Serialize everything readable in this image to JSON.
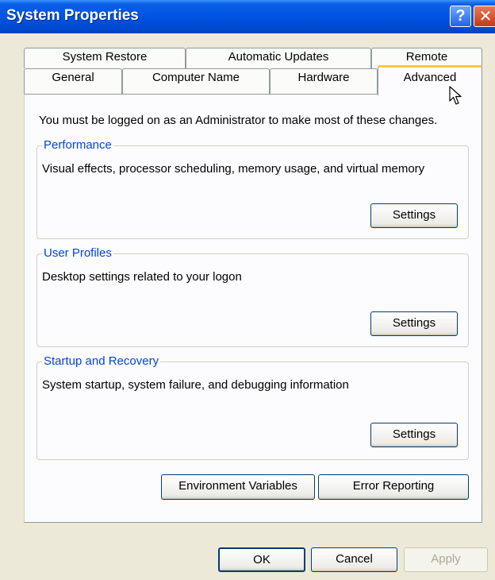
{
  "window": {
    "title": "System Properties",
    "help_glyph": "?",
    "close_glyph": "✕"
  },
  "tabs": {
    "top_row": [
      "System Restore",
      "Automatic Updates",
      "Remote"
    ],
    "bottom_row": [
      "General",
      "Computer Name",
      "Hardware",
      "Advanced"
    ],
    "selected": "Advanced"
  },
  "panel": {
    "intro": "You must be logged on as an Administrator to make most of these changes.",
    "performance": {
      "title": "Performance",
      "description": "Visual effects, processor scheduling, memory usage, and virtual memory",
      "button": "Settings"
    },
    "user_profiles": {
      "title": "User Profiles",
      "description": "Desktop settings related to your logon",
      "button": "Settings"
    },
    "startup_recovery": {
      "title": "Startup and Recovery",
      "description": "System startup, system failure, and debugging information",
      "button": "Settings"
    },
    "environment_variables": "Environment Variables",
    "error_reporting": "Error Reporting"
  },
  "footer": {
    "ok": "OK",
    "cancel": "Cancel",
    "apply": "Apply"
  },
  "colors": {
    "title_bar": "#0054e3",
    "dialog_bg": "#ece9d8",
    "group_title": "#0046d5",
    "selected_tab_highlight": "#ffc83c",
    "disabled_text": "#aca899"
  },
  "icons": {
    "help": "help-icon",
    "close": "close-icon",
    "cursor": "mouse-pointer-icon"
  }
}
